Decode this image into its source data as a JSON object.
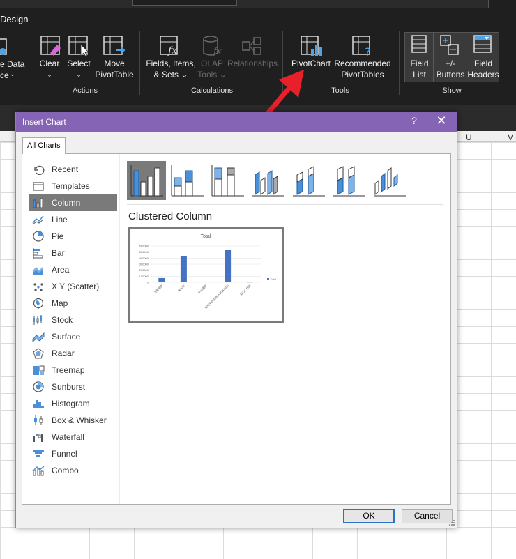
{
  "ribbon": {
    "tab_label": "Design",
    "buttons": {
      "change_data_line1": "e Data",
      "change_data_line2": "ce",
      "clear": "Clear",
      "select": "Select",
      "move_line1": "Move",
      "move_line2": "PivotTable",
      "fields_line1": "Fields, Items,",
      "fields_line2": "& Sets",
      "olap_line1": "OLAP",
      "olap_line2": "Tools",
      "relationships": "Relationships",
      "pivotchart": "PivotChart",
      "recommended_line1": "Recommended",
      "recommended_line2": "PivotTables",
      "field_list_line1": "Field",
      "field_list_line2": "List",
      "plusminus_line1": "+/-",
      "plusminus_line2": "Buttons",
      "field_headers_line1": "Field",
      "field_headers_line2": "Headers"
    },
    "groups": {
      "actions": "Actions",
      "calculations": "Calculations",
      "tools": "Tools",
      "show": "Show"
    }
  },
  "sheet": {
    "col_u": "U",
    "col_v": "V"
  },
  "dialog": {
    "title": "Insert Chart",
    "help": "?",
    "close": "✕",
    "tab": "All Charts",
    "chart_types": [
      {
        "label": "Recent",
        "icon": "recent-icon"
      },
      {
        "label": "Templates",
        "icon": "templates-icon"
      },
      {
        "label": "Column",
        "icon": "column-chart-icon",
        "selected": true
      },
      {
        "label": "Line",
        "icon": "line-chart-icon"
      },
      {
        "label": "Pie",
        "icon": "pie-chart-icon"
      },
      {
        "label": "Bar",
        "icon": "bar-chart-icon"
      },
      {
        "label": "Area",
        "icon": "area-chart-icon"
      },
      {
        "label": "X Y (Scatter)",
        "icon": "scatter-chart-icon"
      },
      {
        "label": "Map",
        "icon": "map-chart-icon"
      },
      {
        "label": "Stock",
        "icon": "stock-chart-icon"
      },
      {
        "label": "Surface",
        "icon": "surface-chart-icon"
      },
      {
        "label": "Radar",
        "icon": "radar-chart-icon"
      },
      {
        "label": "Treemap",
        "icon": "treemap-chart-icon"
      },
      {
        "label": "Sunburst",
        "icon": "sunburst-chart-icon"
      },
      {
        "label": "Histogram",
        "icon": "histogram-chart-icon"
      },
      {
        "label": "Box & Whisker",
        "icon": "box-whisker-chart-icon"
      },
      {
        "label": "Waterfall",
        "icon": "waterfall-chart-icon"
      },
      {
        "label": "Funnel",
        "icon": "funnel-chart-icon"
      },
      {
        "label": "Combo",
        "icon": "combo-chart-icon"
      }
    ],
    "subtypes": [
      "clustered-column-icon",
      "stacked-column-icon",
      "100-stacked-column-icon",
      "3d-clustered-column-icon",
      "3d-stacked-column-icon",
      "3d-100-stacked-column-icon",
      "3d-column-icon"
    ],
    "preview_title": "Clustered Column",
    "ok": "OK",
    "cancel": "Cancel"
  },
  "chart_data": {
    "type": "bar",
    "title": "Total",
    "categories": [
      "五東福店",
      "宝山店",
      "中心園店",
      "普陀平价菜场(人民路口店)",
      "虹口广场店"
    ],
    "series": [
      {
        "name": "Total",
        "values": [
          70000,
          430000,
          8000,
          540000,
          5000
        ]
      }
    ],
    "ylim": [
      0,
      600000
    ],
    "yticks": [
      "600000",
      "500000",
      "400000",
      "300000",
      "200000",
      "100000",
      "0"
    ],
    "legend": "right",
    "colors": {
      "bar": "#4472c4"
    }
  },
  "colors": {
    "titlebar": "#8563b5",
    "arrow": "#e8202a",
    "accent": "#2a72c8"
  }
}
